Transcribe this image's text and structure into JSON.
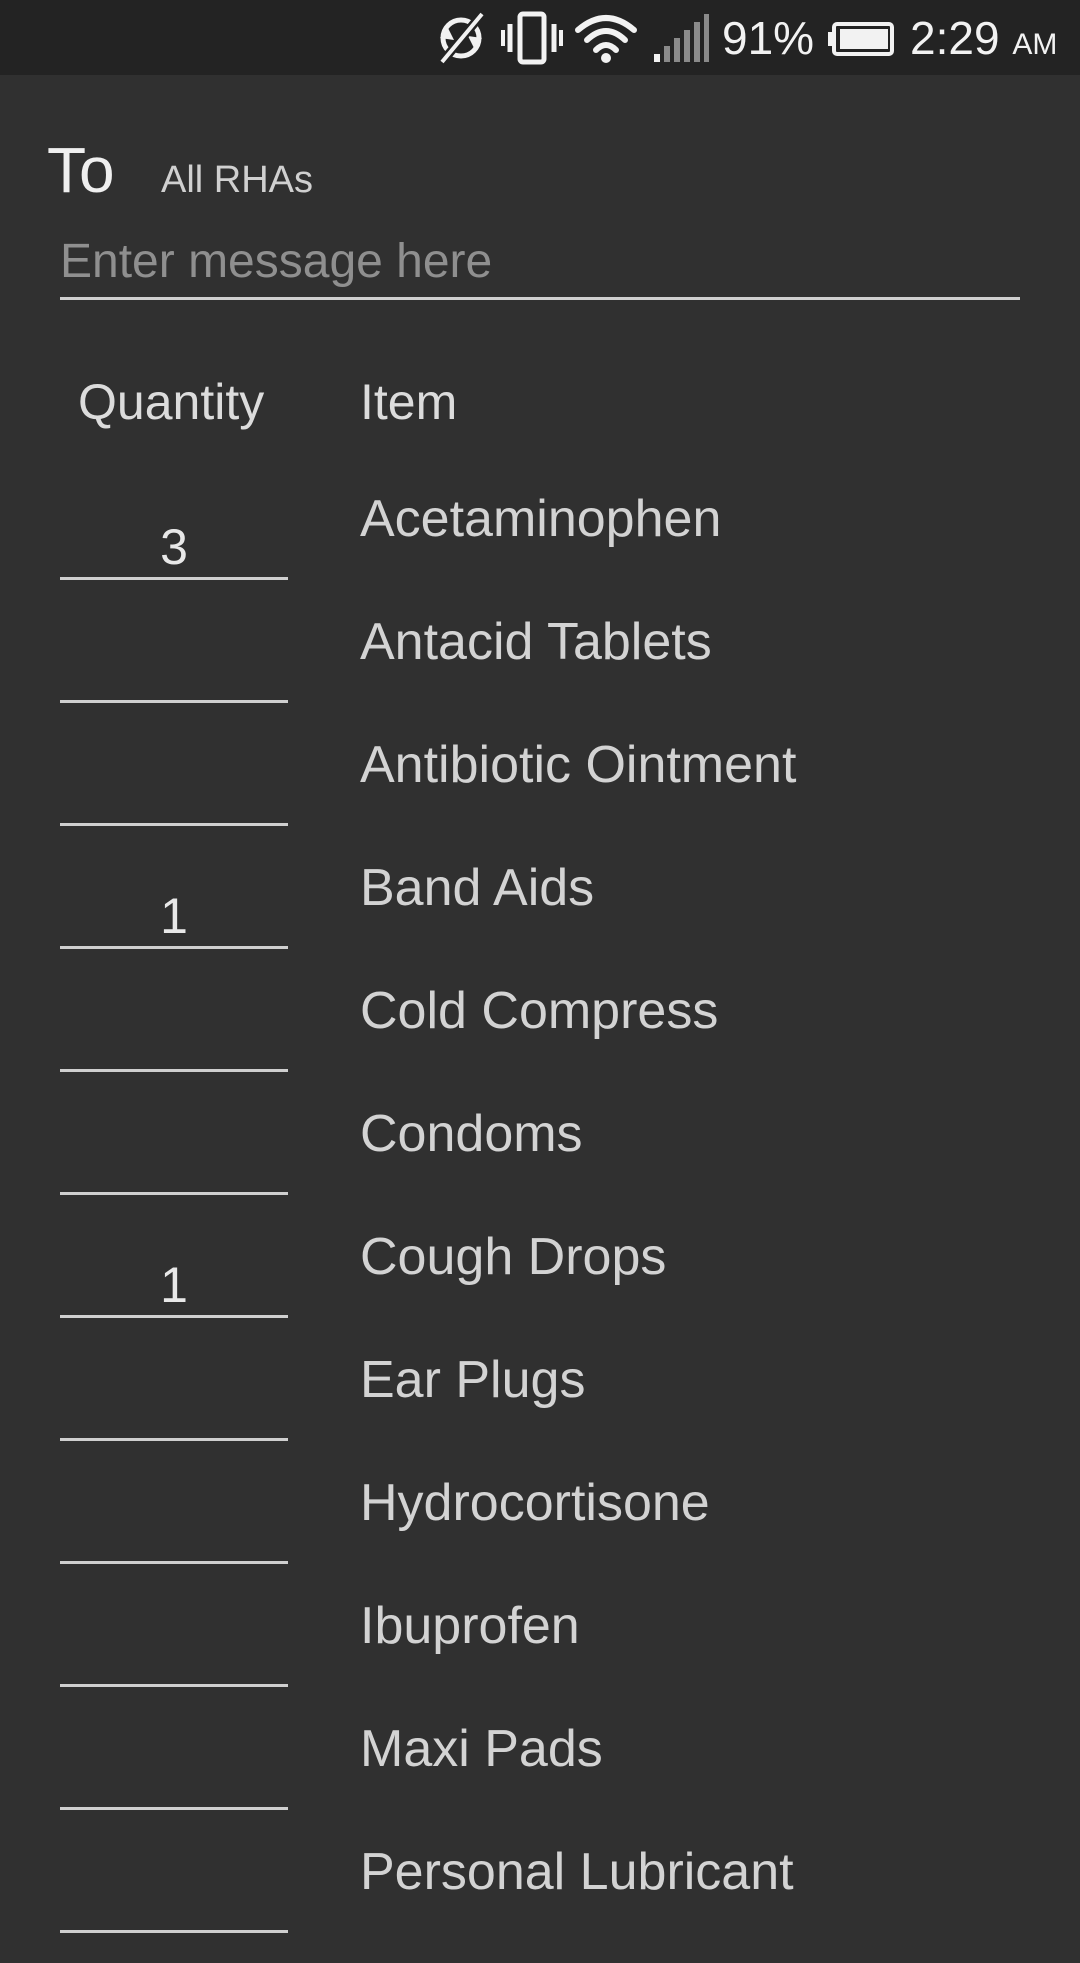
{
  "status_bar": {
    "icons": [
      "sync-off-icon",
      "vibrate-icon",
      "wifi-icon",
      "signal-icon",
      "battery-icon"
    ],
    "battery_percent": "91%",
    "time": "2:29",
    "ampm": "AM"
  },
  "compose": {
    "to_label": "To",
    "recipient": "All RHAs",
    "message_placeholder": "Enter message here",
    "message_value": ""
  },
  "table": {
    "quantity_header": "Quantity",
    "item_header": "Item",
    "rows": [
      {
        "quantity": "3",
        "item": "Acetaminophen"
      },
      {
        "quantity": "",
        "item": "Antacid Tablets"
      },
      {
        "quantity": "",
        "item": "Antibiotic Ointment"
      },
      {
        "quantity": "1",
        "item": "Band Aids"
      },
      {
        "quantity": "",
        "item": "Cold Compress"
      },
      {
        "quantity": "",
        "item": "Condoms"
      },
      {
        "quantity": "1",
        "item": "Cough Drops"
      },
      {
        "quantity": "",
        "item": "Ear Plugs"
      },
      {
        "quantity": "",
        "item": "Hydrocortisone"
      },
      {
        "quantity": "",
        "item": "Ibuprofen"
      },
      {
        "quantity": "",
        "item": "Maxi Pads"
      },
      {
        "quantity": "",
        "item": "Personal Lubricant"
      }
    ]
  },
  "colors": {
    "background": "#303030",
    "status_bar": "#232323",
    "divider": "#cfcfcf"
  }
}
